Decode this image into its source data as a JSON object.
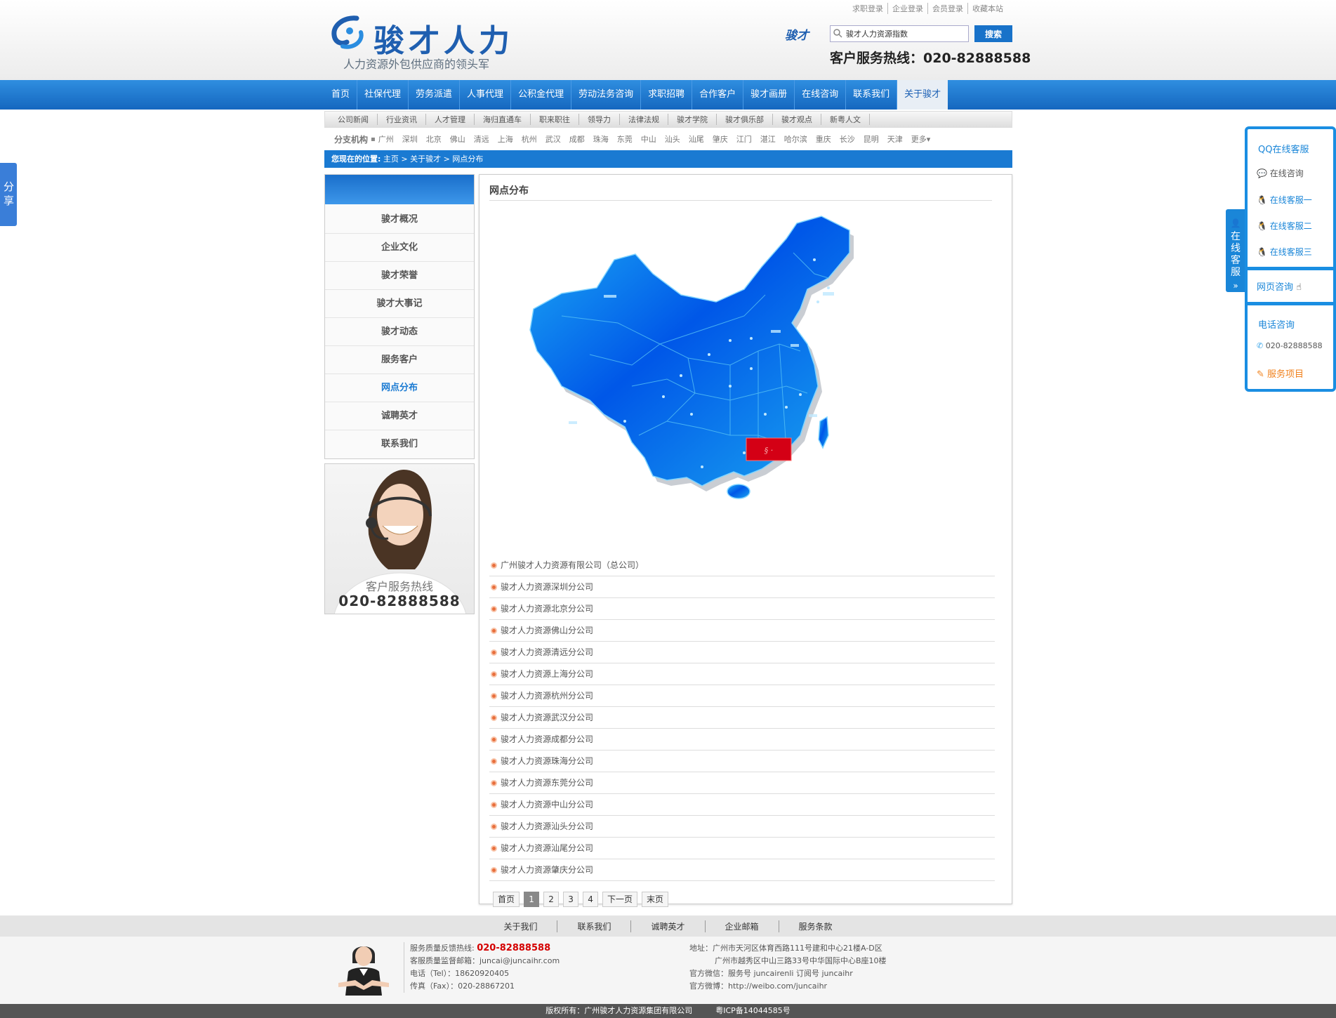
{
  "header": {
    "brand": "骏才人力",
    "slogan": "人力资源外包供应商的领头军",
    "top_links": [
      "求职登录",
      "企业登录",
      "会员登录",
      "收藏本站"
    ],
    "search_logo_text": "骏才",
    "search_value": "骏才人力资源指数",
    "search_button": "搜索",
    "hotline": "客户服务热线：020-82888588"
  },
  "main_nav": [
    "首页",
    "社保代理",
    "劳务派遣",
    "人事代理",
    "公积金代理",
    "劳动法务咨询",
    "求职招聘",
    "合作客户",
    "骏才画册",
    "在线咨询",
    "联系我们",
    "关于骏才"
  ],
  "sub_nav": [
    "公司新闻",
    "行业资讯",
    "人才管理",
    "海归直通车",
    "职来职往",
    "领导力",
    "法律法规",
    "骏才学院",
    "骏才俱乐部",
    "骏才观点",
    "新粤人文"
  ],
  "branch_bar": {
    "label": "分支机构",
    "cities": [
      "广州",
      "深圳",
      "北京",
      "佛山",
      "清远",
      "上海",
      "杭州",
      "武汉",
      "成都",
      "珠海",
      "东莞",
      "中山",
      "汕头",
      "汕尾",
      "肇庆",
      "江门",
      "湛江",
      "哈尔滨",
      "重庆",
      "长沙",
      "昆明",
      "天津"
    ],
    "more": "更多"
  },
  "breadcrumb": {
    "prefix": "您现在的位置:",
    "items": [
      "主页",
      "关于骏才",
      "网点分布"
    ],
    "sep": " > "
  },
  "sidebar": {
    "items": [
      "骏才概况",
      "企业文化",
      "骏才荣誉",
      "骏才大事记",
      "骏才动态",
      "服务客户",
      "网点分布",
      "诚聘英才",
      "联系我们"
    ],
    "active_index": 6
  },
  "promo": {
    "line1": "客户服务热线",
    "line2": "020-82888588"
  },
  "content": {
    "title": "网点分布",
    "offices": [
      "广州骏才人力资源有限公司（总公司）",
      "骏才人力资源深圳分公司",
      "骏才人力资源北京分公司",
      "骏才人力资源佛山分公司",
      "骏才人力资源清远分公司",
      "骏才人力资源上海分公司",
      "骏才人力资源杭州分公司",
      "骏才人力资源武汉分公司",
      "骏才人力资源成都分公司",
      "骏才人力资源珠海分公司",
      "骏才人力资源东莞分公司",
      "骏才人力资源中山分公司",
      "骏才人力资源汕头分公司",
      "骏才人力资源汕尾分公司",
      "骏才人力资源肇庆分公司"
    ],
    "pager": [
      "首页",
      "1",
      "2",
      "3",
      "4",
      "下一页",
      "末页"
    ],
    "pager_current": "1"
  },
  "footer_nav": [
    "关于我们",
    "联系我们",
    "诚聘英才",
    "企业邮箱",
    "服务条款"
  ],
  "footer_contact": {
    "hotline_label": "服务质量反馈热线:",
    "hotline": "020-82888588",
    "email": "客服质量监督邮箱：juncai@juncaihr.com",
    "tel": "电话（Tel）：18620920405",
    "fax": "传真（Fax）：020-28867201"
  },
  "footer_address": {
    "line1": "地址：广州市天河区体育西路111号建和中心21楼A-D区",
    "line2": "广州市越秀区中山三路33号中华国际中心B座10楼",
    "wechat": "官方微信：服务号 juncairenli 订阅号 juncaihr",
    "weibo": "官方微博：http://weibo.com/juncaihr"
  },
  "copyright": "版权所有：广州骏才人力资源集团有限公司　　　粤ICP备14044585号",
  "share_text": "分享",
  "cs_panel": {
    "tab_text": "在线客服",
    "qq_title": "QQ在线客服",
    "online_consult": "在线咨询",
    "agents": [
      "在线客服一",
      "在线客服二",
      "在线客服三"
    ],
    "web_consult": "网页咨询",
    "phone_title": "电话咨询",
    "phone": "020-82888588",
    "services": "服务项目"
  },
  "colors": {
    "brand_blue": "#1a7ad2",
    "nav_blue": "#1567bf",
    "accent_orange": "#e86f3d",
    "hotline_red": "#d40000"
  }
}
